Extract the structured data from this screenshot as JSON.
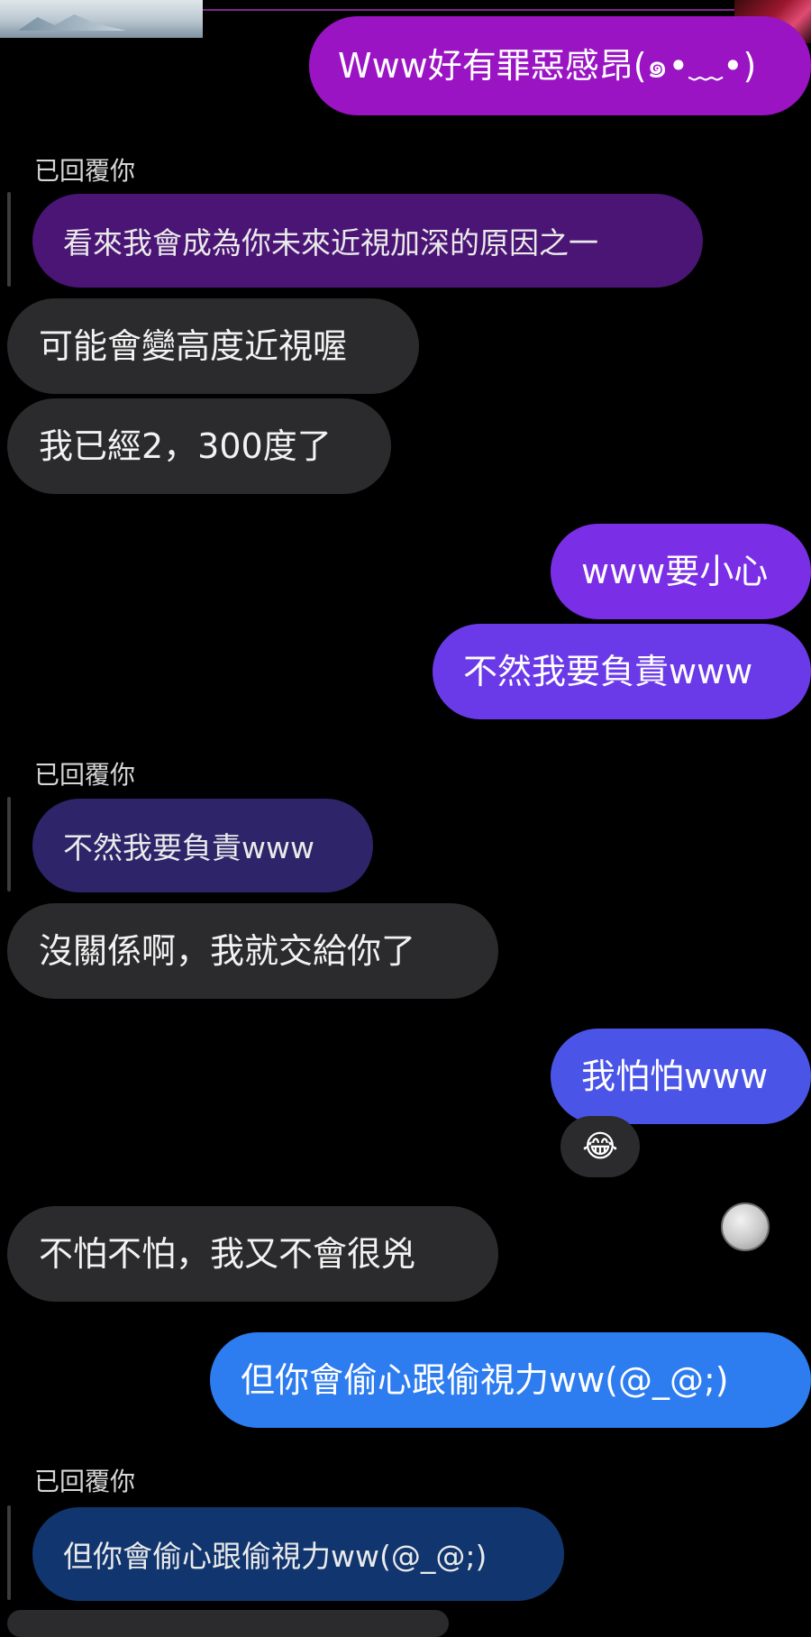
{
  "messages": {
    "m1": "Www好有罪惡感昂(๑•﹏•)",
    "m2": "可能會變高度近視喔",
    "m3": "我已經2，300度了",
    "m4": "www要小心",
    "m5": "不然我要負責www",
    "m6": "沒關係啊，我就交給你了",
    "m7": "我怕怕www",
    "m8": "不怕不怕，我又不會很兇",
    "m9": "但你會偷心跟偷視力ww(@_@;)"
  },
  "replies": {
    "r1": {
      "label": "已回覆你",
      "quoted": "看來我會成為你未來近視加深的原因之一"
    },
    "r2": {
      "label": "已回覆你",
      "quoted": "不然我要負責www"
    },
    "r3": {
      "label": "已回覆你",
      "quoted": "但你會偷心跟偷視力ww(@_@;)"
    }
  },
  "reaction": {
    "emoji": "😂"
  },
  "colors": {
    "outgoing_gradient": [
      "#a218c8",
      "#8a2ee0",
      "#7336e8",
      "#5e44e6",
      "#4a55e8",
      "#2d7cf0"
    ],
    "incoming": "#2b2b2d",
    "background": "#000000"
  }
}
